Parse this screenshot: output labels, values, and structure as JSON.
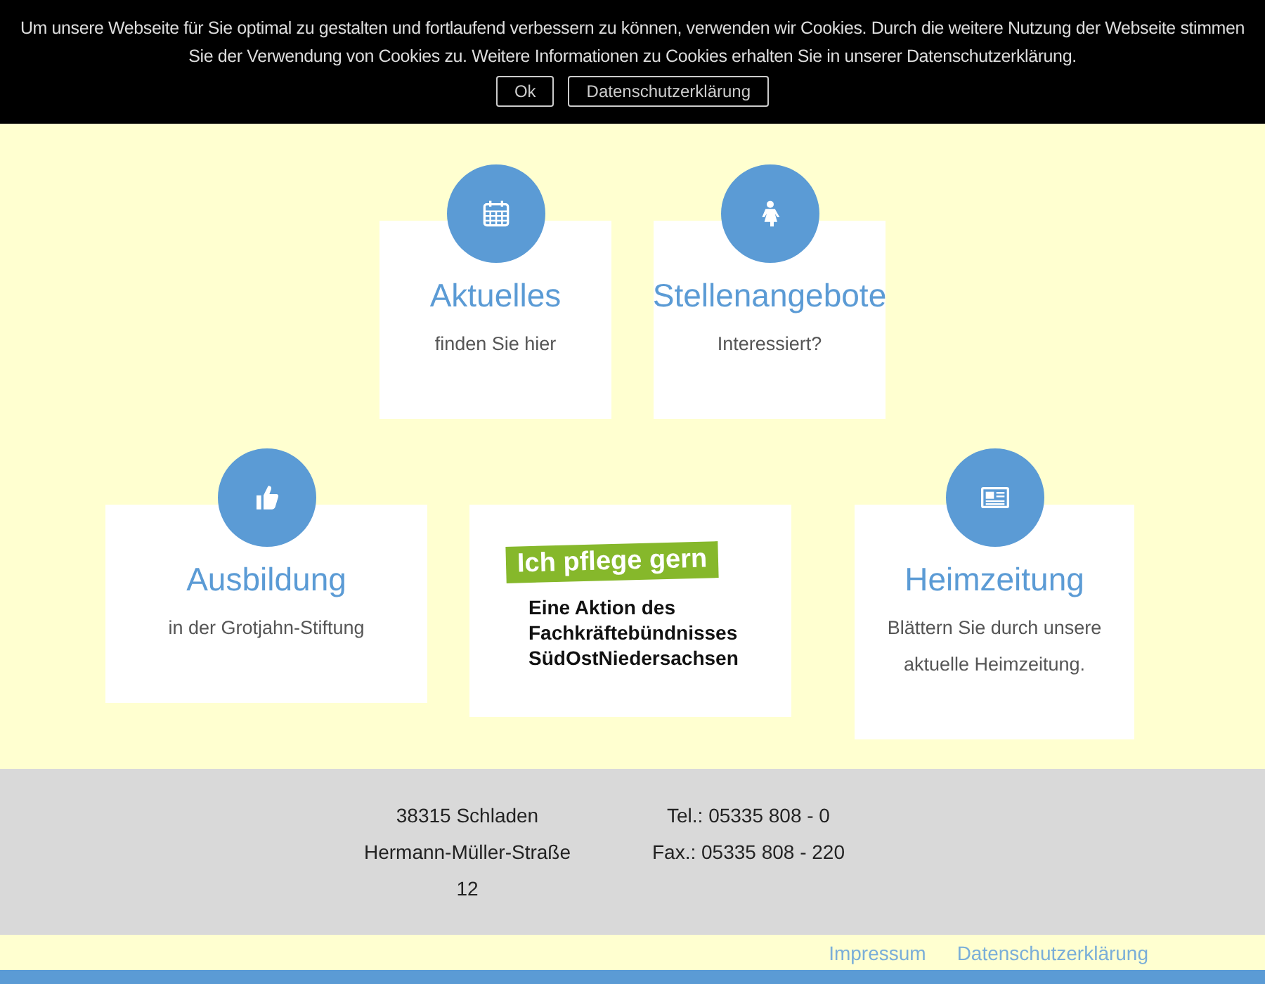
{
  "cookie_banner": {
    "text": "Um unsere Webseite für Sie optimal zu gestalten und fortlaufend verbessern zu können, verwenden wir Cookies. Durch die weitere Nutzung der Webseite stimmen Sie der Verwendung von Cookies zu. Weitere Informationen zu Cookies erhalten Sie in unserer Datenschutzerklärung.",
    "buttons": [
      "Ok",
      "Datenschutzerklärung"
    ]
  },
  "rows": [
    [
      {
        "kind": "feature",
        "title": "Aktuelles",
        "text": "finden Sie hier"
      },
      {
        "kind": "feature",
        "title": "Stellenangebote",
        "text": "Interessiert?"
      }
    ],
    [
      {
        "kind": "feature",
        "title": "Ausbildung",
        "text": "in der Grotjahn-Stiftung"
      },
      {
        "kind": "logo",
        "headline": "Ich pflege gern",
        "lines": [
          "Eine Aktion des",
          "Fachkräftebündnisses",
          "SüdOstNiedersachsen"
        ]
      },
      {
        "kind": "feature",
        "title": "Heimzeitung",
        "text": "Blättern Sie durch unsere aktuelle Heimzeitung."
      }
    ]
  ],
  "footer": {
    "address": [
      "38315 Schladen",
      "Hermann-Müller-Straße 12"
    ],
    "contact": [
      "Tel.: 05335 808 - 0",
      "Fax.: 05335 808 - 220"
    ]
  },
  "links": [
    "Impressum",
    "Datenschutzerklärung"
  ]
}
